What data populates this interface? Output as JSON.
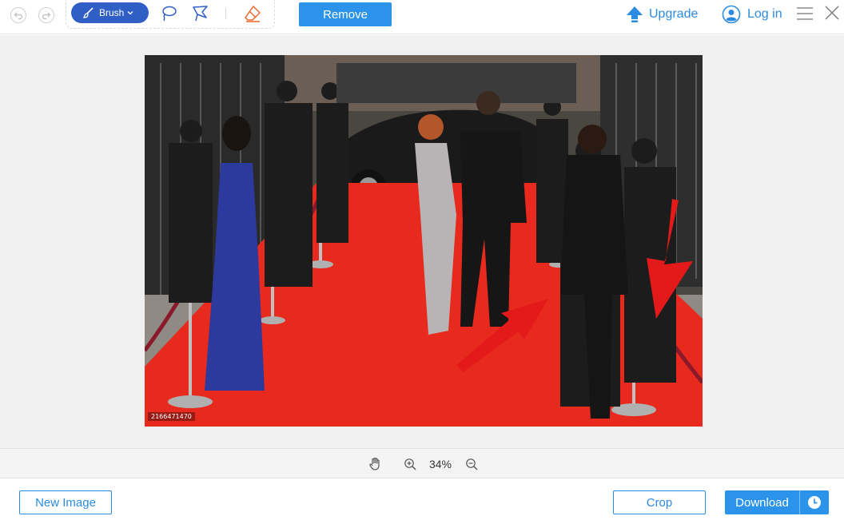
{
  "toolbar": {
    "brush_label": "Brush",
    "remove_label": "Remove",
    "upgrade_label": "Upgrade",
    "login_label": "Log in",
    "icons": [
      "undo-icon",
      "redo-icon",
      "brush-icon",
      "chevron-down-icon",
      "lasso-icon",
      "polygon-lasso-icon",
      "eraser-icon",
      "upgrade-arrow-icon",
      "user-icon",
      "menu-icon",
      "close-icon"
    ]
  },
  "canvas": {
    "photo_credit": "2166471470"
  },
  "zoom": {
    "level": "34%",
    "icons": [
      "hand-icon",
      "zoom-in-icon",
      "zoom-out-icon"
    ]
  },
  "bottom": {
    "new_image_label": "New Image",
    "crop_label": "Crop",
    "download_label": "Download"
  },
  "colors": {
    "accent": "#2b93ea",
    "brush_active": "#2f5fc4",
    "link": "#2b8be0",
    "carpet": "#e8291e",
    "canvas_bg": "#f0f0f0"
  }
}
